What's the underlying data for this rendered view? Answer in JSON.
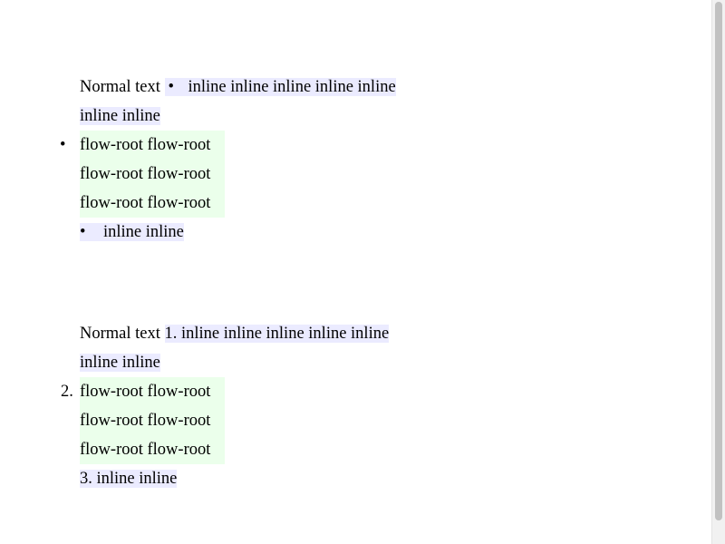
{
  "section1": {
    "normal_text": "Normal text",
    "bullet": "•",
    "inline_first": "inline inline inline inline inline",
    "inline_wrap": "inline inline",
    "flow_lines": [
      "flow-root flow-root",
      "flow-root flow-root",
      "flow-root flow-root"
    ],
    "inline_last": "inline inline"
  },
  "section2": {
    "normal_text": "Normal text",
    "marker1": "1.",
    "inline_first": "inline inline inline inline inline",
    "inline_wrap": "inline inline",
    "marker2": "2.",
    "flow_lines": [
      "flow-root flow-root",
      "flow-root flow-root",
      "flow-root flow-root"
    ],
    "marker3": "3.",
    "inline_last": "inline inline"
  },
  "colors": {
    "inline_bg": "#ebebff",
    "flow_bg": "#ebffeb"
  }
}
